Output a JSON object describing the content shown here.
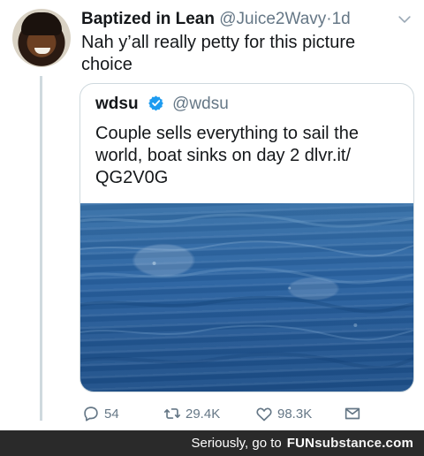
{
  "tweet": {
    "display_name": "Baptized in Lean",
    "handle": "@Juice2Wavy",
    "separator": "·",
    "time": "1d",
    "text": "Nah y’all really petty for this picture choice",
    "more_icon": "chevron-down-icon"
  },
  "quote": {
    "name": "wdsu",
    "verified_icon": "verified-badge-icon",
    "handle": "@wdsu",
    "text": "Couple sells everything to sail the world, boat sinks on day 2 dlvr.it/ QG2V0G",
    "image_icon": "ocean-photo"
  },
  "actions": {
    "reply_count": "54",
    "retweet_count": "29.4K",
    "like_count": "98.3K",
    "reply_icon": "reply-icon",
    "retweet_icon": "retweet-icon",
    "like_icon": "heart-icon",
    "share_icon": "share-icon"
  },
  "footer": {
    "lead": "Seriously, go to",
    "brand_prefix": "FUN",
    "brand_suffix": "substance",
    "brand_domain": ".com"
  },
  "colors": {
    "text": "#14171a",
    "secondary": "#657786",
    "border": "#cfd9de",
    "verified": "#1d9bf0",
    "footer_bg": "#2a2a2a"
  }
}
